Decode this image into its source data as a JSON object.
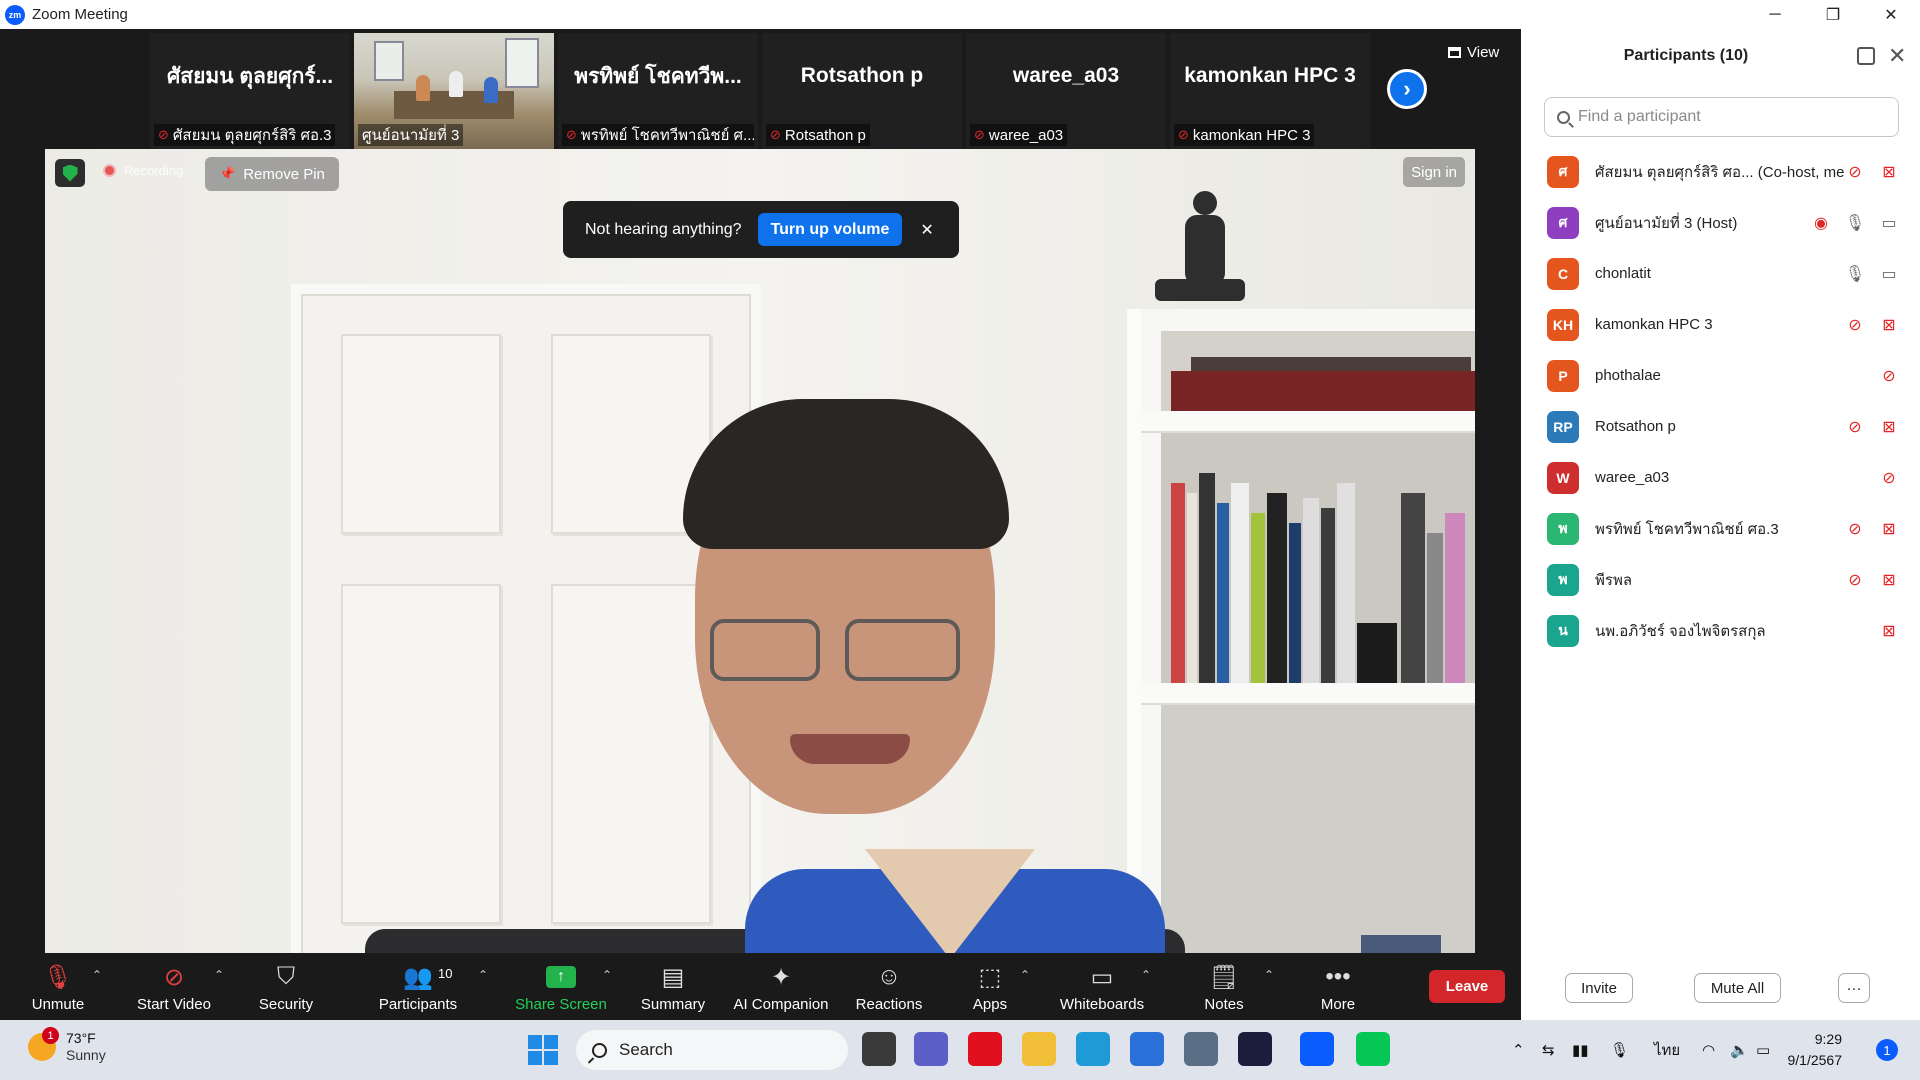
{
  "window": {
    "logo": "zm",
    "title": "Zoom Meeting",
    "controls": [
      "minimize-icon",
      "restore-icon",
      "close-icon"
    ]
  },
  "thumbnails": [
    {
      "big_name": "ศัสยมน ตุลยศุกร์...",
      "label": "ศัสยมน ตุลยศุกร์สิริ ศอ.3",
      "muted": true,
      "video": false
    },
    {
      "big_name": "",
      "label": "ศูนย์อนามัยที่ 3",
      "muted": false,
      "video": true
    },
    {
      "big_name": "พรทิพย์ โชคทวีพ...",
      "label": "พรทิพย์ โชคทวีพาณิชย์ ศ...",
      "muted": true,
      "video": false
    },
    {
      "big_name": "Rotsathon p",
      "label": "Rotsathon p",
      "muted": true,
      "video": false
    },
    {
      "big_name": "waree_a03",
      "label": "waree_a03",
      "muted": true,
      "video": false
    },
    {
      "big_name": "kamonkan HPC 3",
      "label": "kamonkan HPC 3",
      "muted": true,
      "video": false
    }
  ],
  "view_label": "View",
  "main_video": {
    "recording_label": "Recording",
    "remove_pin_label": "Remove Pin",
    "sign_in_label": "Sign in",
    "speaker_name": "chonlatit"
  },
  "toast": {
    "message": "Not hearing anything?",
    "button": "Turn up volume"
  },
  "toolbar": {
    "unmute": "Unmute",
    "start_video": "Start Video",
    "security": "Security",
    "participants": "Participants",
    "participants_count": "10",
    "share_screen": "Share Screen",
    "summary": "Summary",
    "ai_companion": "AI Companion",
    "reactions": "Reactions",
    "apps": "Apps",
    "whiteboards": "Whiteboards",
    "notes": "Notes",
    "more": "More",
    "leave": "Leave"
  },
  "panel": {
    "title": "Participants (10)",
    "search_placeholder": "Find a participant",
    "participants": [
      {
        "initial": "ศ",
        "name": "ศัสยมน ตุลยศุกร์สิริ ศอ... (Co-host, me)",
        "color": "#e5561f",
        "icons": [
          "mic-off",
          "video-off"
        ]
      },
      {
        "initial": "ศ",
        "name": "ศูนย์อนามัยที่ 3 (Host)",
        "color": "#8e3fbf",
        "icons": [
          "recording",
          "mic-on",
          "video-on"
        ]
      },
      {
        "initial": "C",
        "name": "chonlatit",
        "color": "#e5561f",
        "icons": [
          "mic-on",
          "video-on"
        ]
      },
      {
        "initial": "KH",
        "name": "kamonkan HPC 3",
        "color": "#e5561f",
        "icons": [
          "mic-off",
          "video-off"
        ]
      },
      {
        "initial": "P",
        "name": "phothalae",
        "color": "#e5561f",
        "icons": [
          "mic-off"
        ]
      },
      {
        "initial": "RP",
        "name": "Rotsathon p",
        "color": "#2d7ab8",
        "icons": [
          "mic-off",
          "video-off"
        ]
      },
      {
        "initial": "W",
        "name": "waree_a03",
        "color": "#cf2e2e",
        "icons": [
          "mic-off"
        ]
      },
      {
        "initial": "พ",
        "name": "พรทิพย์ โชคทวีพาณิชย์ ศอ.3",
        "color": "#2bb673",
        "icons": [
          "mic-off",
          "video-off"
        ]
      },
      {
        "initial": "พ",
        "name": "พีรพล",
        "color": "#1aa58e",
        "icons": [
          "mic-off",
          "video-off"
        ]
      },
      {
        "initial": "น",
        "name": "นพ.อภิวัชร์ จองไพจิตรสกุล",
        "color": "#1aa58e",
        "icons": [
          "video-off"
        ]
      }
    ],
    "invite": "Invite",
    "mute_all": "Mute All",
    "more": "···"
  },
  "taskbar": {
    "weather_badge": "1",
    "temperature": "73°F",
    "condition": "Sunny",
    "search_label": "Search",
    "language": "ไทย",
    "time": "9:29",
    "date": "9/1/2567",
    "notification_count": "1",
    "apps": [
      {
        "name": "file-explorer-icon",
        "color": "#3a3a3a"
      },
      {
        "name": "teams-icon",
        "color": "#5b5fc7"
      },
      {
        "name": "opera-icon",
        "color": "#e0101f"
      },
      {
        "name": "folder-icon",
        "color": "#f2c038"
      },
      {
        "name": "edge-icon",
        "color": "#1e9bd7"
      },
      {
        "name": "store-icon",
        "color": "#2b6fd8"
      },
      {
        "name": "photos-icon",
        "color": "#5a6f86"
      },
      {
        "name": "webex-icon",
        "color": "#1c1c3c"
      },
      {
        "name": "zoom-icon",
        "color": "#0b5cff"
      },
      {
        "name": "line-icon",
        "color": "#06c755"
      }
    ]
  }
}
